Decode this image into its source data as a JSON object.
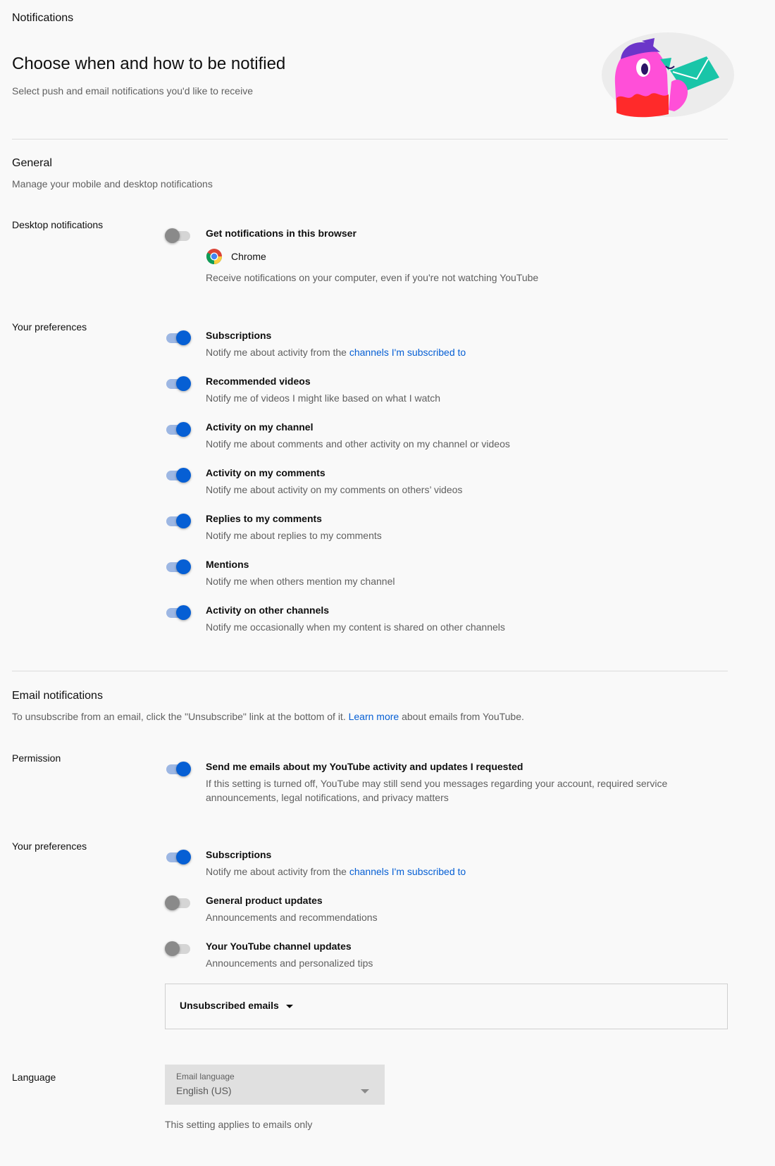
{
  "breadcrumb": "Notifications",
  "hero": {
    "title": "Choose when and how to be notified",
    "subtitle": "Select push and email notifications you'd like to receive"
  },
  "general": {
    "title": "General",
    "subtitle": "Manage your mobile and desktop notifications",
    "desktop_label": "Desktop notifications",
    "desktop": {
      "title": "Get notifications in this browser",
      "browser": "Chrome",
      "desc": "Receive notifications on your computer, even if you're not watching YouTube",
      "enabled": false
    },
    "prefs_label": "Your preferences",
    "prefs": [
      {
        "title": "Subscriptions",
        "desc_prefix": "Notify me about activity from the ",
        "desc_link": "channels I'm subscribed to",
        "enabled": true
      },
      {
        "title": "Recommended videos",
        "desc": "Notify me of videos I might like based on what I watch",
        "enabled": true
      },
      {
        "title": "Activity on my channel",
        "desc": "Notify me about comments and other activity on my channel or videos",
        "enabled": true
      },
      {
        "title": "Activity on my comments",
        "desc": "Notify me about activity on my comments on others’ videos",
        "enabled": true
      },
      {
        "title": "Replies to my comments",
        "desc": "Notify me about replies to my comments",
        "enabled": true
      },
      {
        "title": "Mentions",
        "desc": "Notify me when others mention my channel",
        "enabled": true
      },
      {
        "title": "Activity on other channels",
        "desc": "Notify me occasionally when my content is shared on other channels",
        "enabled": true
      }
    ]
  },
  "email": {
    "title": "Email notifications",
    "subtitle_prefix": "To unsubscribe from an email, click the \"Unsubscribe\" link at the bottom of it. ",
    "subtitle_link": "Learn more",
    "subtitle_suffix": " about emails from YouTube.",
    "permission_label": "Permission",
    "permission": {
      "title": "Send me emails about my YouTube activity and updates I requested",
      "desc": "If this setting is turned off, YouTube may still send you messages regarding your account, required service announcements, legal notifications, and privacy matters",
      "enabled": true
    },
    "prefs_label": "Your preferences",
    "prefs": [
      {
        "title": "Subscriptions",
        "desc_prefix": "Notify me about activity from the ",
        "desc_link": "channels I'm subscribed to",
        "enabled": true
      },
      {
        "title": "General product updates",
        "desc": "Announcements and recommendations",
        "enabled": false
      },
      {
        "title": "Your YouTube channel updates",
        "desc": "Announcements and personalized tips",
        "enabled": false
      }
    ],
    "unsubscribed_label": "Unsubscribed emails"
  },
  "language": {
    "label": "Language",
    "field_caption": "Email language",
    "value": "English (US)",
    "note": "This setting applies to emails only"
  },
  "colors": {
    "background": "#f9f9f9",
    "accent": "#065fd4",
    "secondary_text": "#606060"
  }
}
